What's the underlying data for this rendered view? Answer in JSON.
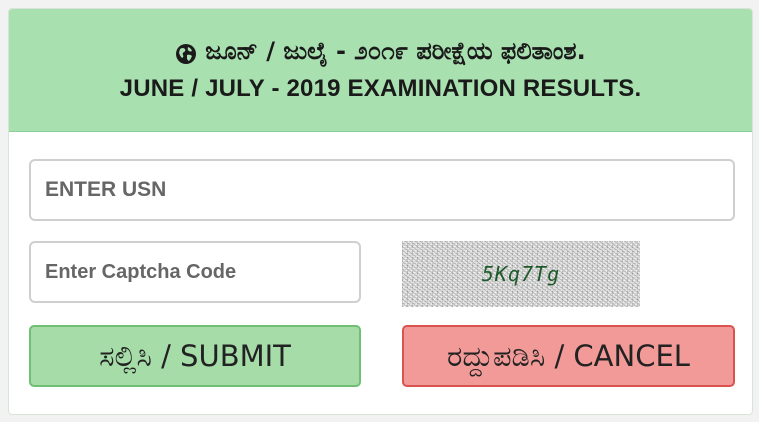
{
  "header": {
    "title_kannada": "ಜೂನ್ / ಜುಲೈ - ೨೦೧೯ ಪರೀಕ್ಷೆಯ ಫಲಿತಾಂಶ.",
    "title_english": "JUNE / JULY - 2019 EXAMINATION RESULTS.",
    "icon": "globe-icon"
  },
  "form": {
    "usn_placeholder": "ENTER USN",
    "usn_value": "",
    "captcha_placeholder": "Enter Captcha Code",
    "captcha_value": "",
    "captcha_image_text": "5Kq7Tg"
  },
  "buttons": {
    "submit_label": "ಸಲ್ಲಿಸಿ / SUBMIT",
    "cancel_label": "ರದ್ದುಪಡಿಸಿ / CANCEL"
  },
  "colors": {
    "header_bg": "#a8e0b0",
    "submit_bg": "#a5dca8",
    "cancel_bg": "#f19a97"
  }
}
